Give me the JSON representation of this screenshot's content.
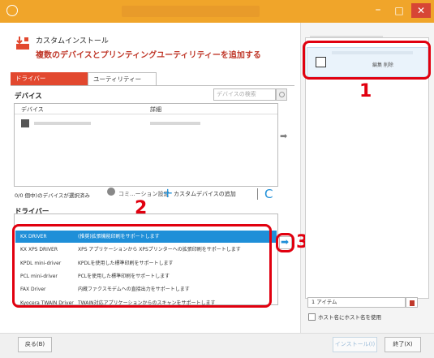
{
  "window": {
    "title": ""
  },
  "header": {
    "title": "カスタムインストール",
    "subtitle": "複数のデバイスとプリンティングユーティリティーを追加する"
  },
  "tabs": [
    {
      "label": "ドライバー"
    },
    {
      "label": "ユーティリティー"
    }
  ],
  "device_section": {
    "label": "デバイス",
    "search_placeholder": "デバイスの検索",
    "col_device": "デバイス",
    "col_detail": "詳細",
    "status": "0/0 個中)のデバイスが選択済み",
    "port_settings": "コミ...ーション設定",
    "add_custom_device": "カスタムデバイスの追加"
  },
  "driver_section": {
    "label": "ドライバー",
    "rows": [
      {
        "name": "KX DRIVER",
        "desc": "(推奨)拡張機能印刷をサポートします",
        "selected": true
      },
      {
        "name": "KX XPS DRIVER",
        "desc": "XPS アプリケーションから XPSプリンターへの拡張印刷をサポートします"
      },
      {
        "name": "KPDL mini-driver",
        "desc": "KPDLを使用した標準印刷をサポートします"
      },
      {
        "name": "PCL mini-driver",
        "desc": "PCLを使用した標準印刷をサポートします"
      },
      {
        "name": "FAX Driver",
        "desc": "内蔵ファクスモデムへの直接出力をサポートします"
      },
      {
        "name": "Kyocera TWAIN Driver",
        "desc": "TWAIN対応アプリケーションからのスキャンをサポートします"
      }
    ]
  },
  "right_panel": {
    "item_actions": "編集 削除",
    "count": "1 アイテム",
    "hostname_checkbox": "ホスト名にホスト名を使用"
  },
  "callouts": {
    "n1": "1",
    "n2": "2",
    "n3": "3"
  },
  "footer": {
    "back": "戻る(B)",
    "install": "インストール(I)",
    "exit": "終了(X)"
  },
  "colors": {
    "titlebar": "#f0a52a",
    "accent_red": "#e1000f",
    "select_blue": "#1f8fd8"
  }
}
